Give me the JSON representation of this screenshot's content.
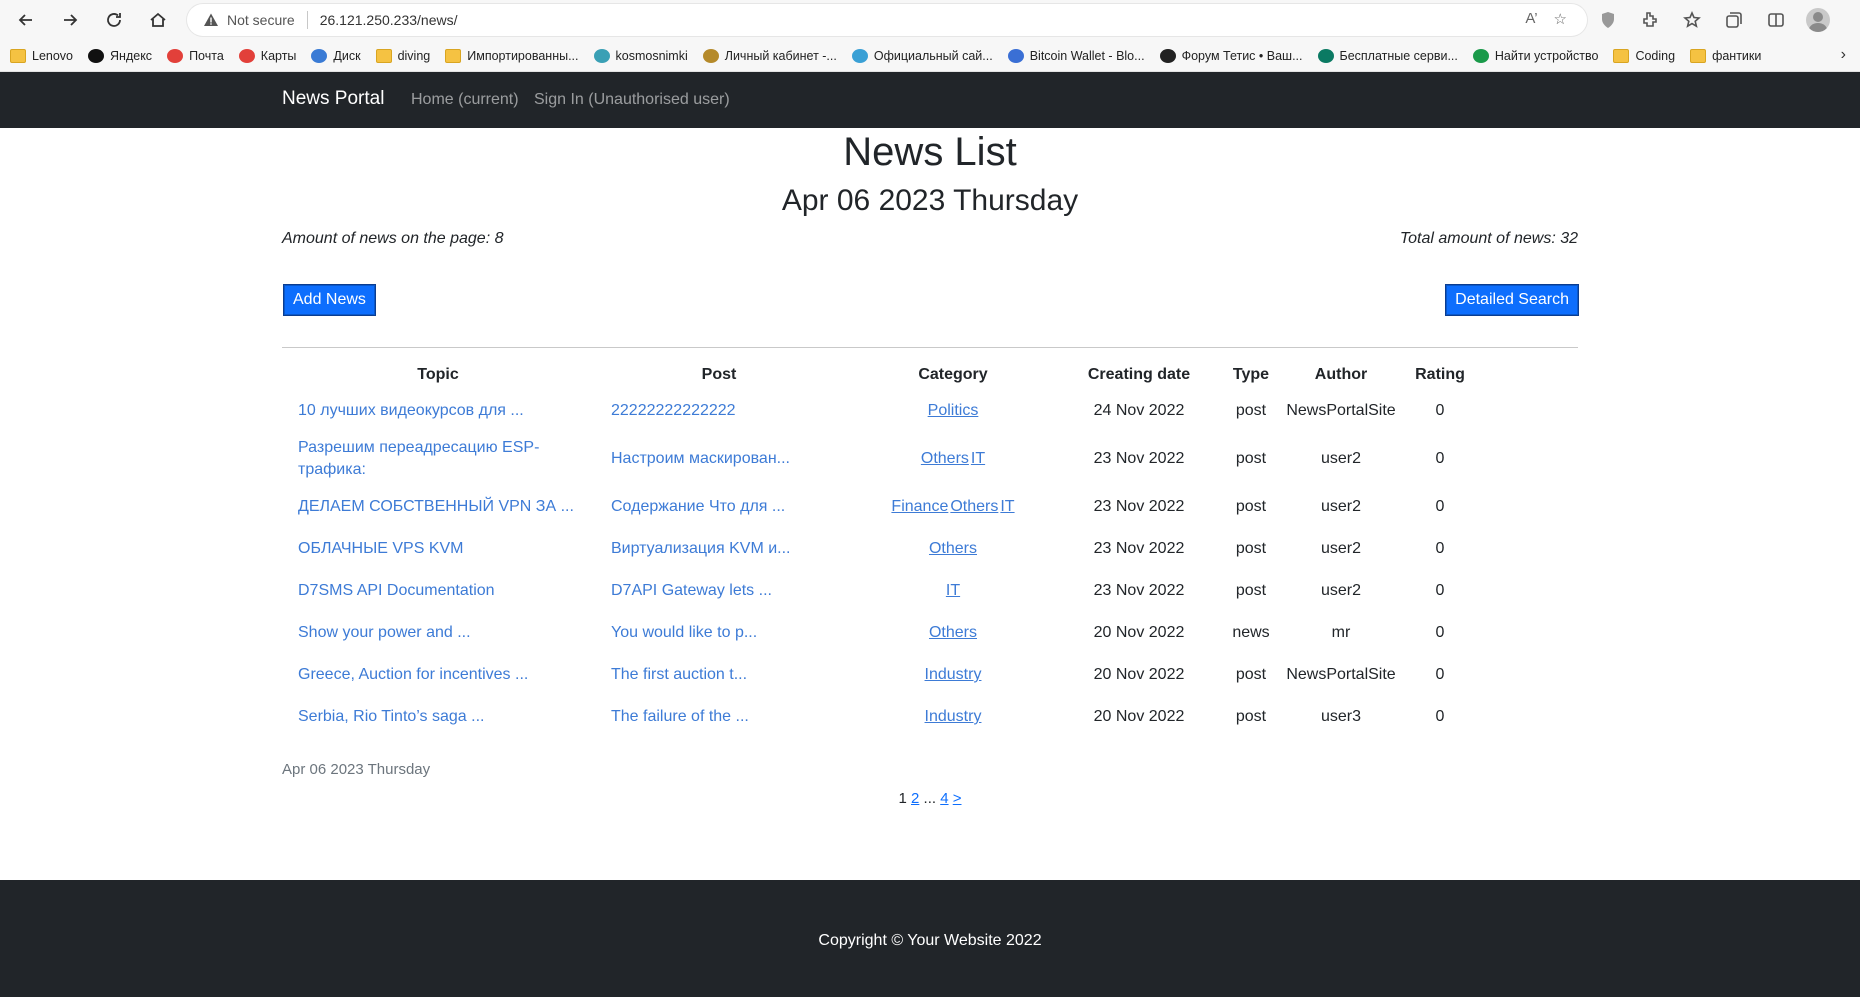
{
  "browser": {
    "not_secure": "Not secure",
    "url": "26.121.250.233/news/",
    "bookmarks": [
      {
        "label": "Lenovo",
        "icon": "folder-icon"
      },
      {
        "label": "Яндекс",
        "icon": "yandex-icon"
      },
      {
        "label": "Почта",
        "icon": "mail-icon"
      },
      {
        "label": "Карты",
        "icon": "maps-icon"
      },
      {
        "label": "Диск",
        "icon": "disk-icon"
      },
      {
        "label": "diving",
        "icon": "folder-icon"
      },
      {
        "label": "Импортированны...",
        "icon": "folder-icon"
      },
      {
        "label": "kosmosnimki",
        "icon": "globe-icon"
      },
      {
        "label": "Личный кабинет -...",
        "icon": "emblem-icon"
      },
      {
        "label": "Официальный сай...",
        "icon": "site-icon"
      },
      {
        "label": "Bitcoin Wallet - Blo...",
        "icon": "cube-icon"
      },
      {
        "label": "Форум Тетис • Ваш...",
        "icon": "forum-icon"
      },
      {
        "label": "Бесплатные серви...",
        "icon": "k-icon"
      },
      {
        "label": "Найти устройство",
        "icon": "device-icon"
      },
      {
        "label": "Coding",
        "icon": "folder-icon"
      },
      {
        "label": "фантики",
        "icon": "folder-icon"
      }
    ]
  },
  "navbar": {
    "brand": "News Portal",
    "home": "Home (current)",
    "signin": "Sign In (Unauthorised user)"
  },
  "page": {
    "title": "News List",
    "date": "Apr 06 2023 Thursday",
    "amount_on_page": "Amount of news on the page: 8",
    "total_amount": "Total amount of news: 32",
    "add_button": "Add News",
    "search_button": "Detailed Search",
    "footer_date": "Apr 06 2023 Thursday"
  },
  "table": {
    "headers": [
      "Topic",
      "Post",
      "Category",
      "Creating date",
      "Type",
      "Author",
      "Rating"
    ],
    "rows": [
      {
        "topic": "10 лучших видеокурсов для ...",
        "post": "22222222222222",
        "categories": [
          "Politics"
        ],
        "date": "24 Nov 2022",
        "type": "post",
        "author": "NewsPortalSite",
        "rating": "0"
      },
      {
        "topic": "Разрешим переадресацию ESP-трафика:",
        "post": "Настроим маскирован...",
        "categories": [
          "Others",
          "IT"
        ],
        "date": "23 Nov 2022",
        "type": "post",
        "author": "user2",
        "rating": "0"
      },
      {
        "topic": "ДЕЛАЕМ СОБСТВЕННЫЙ VPN ЗА ...",
        "post": "Содержание Что для ...",
        "categories": [
          "Finance",
          "Others",
          "IT"
        ],
        "date": "23 Nov 2022",
        "type": "post",
        "author": "user2",
        "rating": "0"
      },
      {
        "topic": "ОБЛАЧНЫЕ VPS KVM",
        "post": "Виртуализация KVM и...",
        "categories": [
          "Others"
        ],
        "date": "23 Nov 2022",
        "type": "post",
        "author": "user2",
        "rating": "0"
      },
      {
        "topic": "D7SMS API Documentation",
        "post": "D7API Gateway lets ...",
        "categories": [
          "IT"
        ],
        "date": "23 Nov 2022",
        "type": "post",
        "author": "user2",
        "rating": "0"
      },
      {
        "topic": "Show your power and ...",
        "post": "You would like to p...",
        "categories": [
          "Others"
        ],
        "date": "20 Nov 2022",
        "type": "news",
        "author": "mr",
        "rating": "0"
      },
      {
        "topic": "Greece, Auction for incentives ...",
        "post": "The first auction t...",
        "categories": [
          "Industry"
        ],
        "date": "20 Nov 2022",
        "type": "post",
        "author": "NewsPortalSite",
        "rating": "0"
      },
      {
        "topic": "Serbia, Rio Tinto’s saga ...",
        "post": "The failure of the ...",
        "categories": [
          "Industry"
        ],
        "date": "20 Nov 2022",
        "type": "post",
        "author": "user3",
        "rating": "0"
      }
    ]
  },
  "pagination": {
    "current": "1",
    "page2": "2",
    "ellipsis": "...",
    "last": "4",
    "next": ">"
  },
  "footer": {
    "copyright": "Copyright © Your Website 2022"
  }
}
